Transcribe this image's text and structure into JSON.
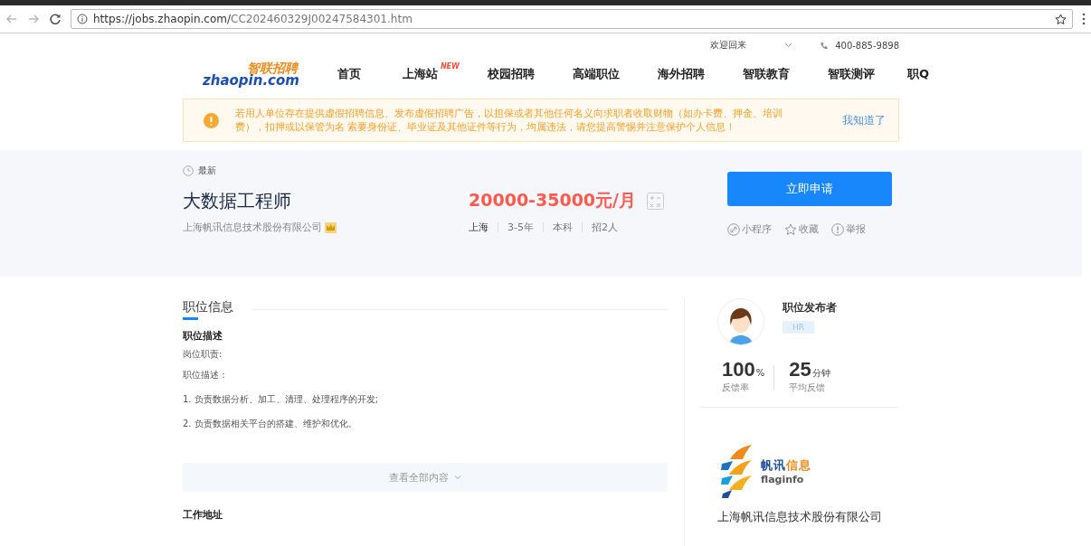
{
  "browser": {
    "url_host": "https://jobs.zhaopin.com/",
    "url_path": "CC202460329J00247584301.htm"
  },
  "header": {
    "welcome": "欢迎回来",
    "phone": "400-885-9898",
    "logo": {
      "cn": "智联招聘",
      "en": "zhaopin.com"
    },
    "nav": [
      {
        "label": "首页"
      },
      {
        "label": "上海站",
        "badge": "NEW"
      },
      {
        "label": "校园招聘"
      },
      {
        "label": "高端职位"
      },
      {
        "label": "海外招聘"
      },
      {
        "label": "智联教育"
      },
      {
        "label": "智联测评"
      },
      {
        "label": "职Q"
      }
    ]
  },
  "notice": {
    "text": "若用人单位存在提供虚假招聘信息、发布虚假招聘广告，以担保或者其他任何名义向求职者收取财物（如办卡费、押金、培训费），扣押或以保管为名 索要身份证、毕业证及其他证件等行为，均属违法，请您提高警惕并注意保护个人信息！",
    "action": "我知道了"
  },
  "job": {
    "tag": "最新",
    "title": "大数据工程师",
    "salary": "20000-35000元/月",
    "company": "上海帆讯信息技术股份有限公司",
    "meta": [
      "上海",
      "3-5年",
      "本科",
      "招2人"
    ],
    "apply": "立即申请",
    "actions": [
      {
        "kind": "miniapp",
        "label": "小程序"
      },
      {
        "kind": "star",
        "label": "收藏"
      },
      {
        "kind": "report",
        "label": "举报"
      }
    ]
  },
  "section": {
    "title": "职位信息",
    "subtitle": "职位描述",
    "lines": [
      "岗位职责:",
      "职位描述：",
      "1. 负责数据分析、加工、清理、处理程序的开发;",
      "2. 负责数据相关平台的搭建、维护和优化。"
    ],
    "more": "查看全部内容",
    "next_heading": "工作地址"
  },
  "publisher": {
    "title": "职位发布者",
    "role": "HR",
    "stats": [
      {
        "value": "100",
        "unit": "%",
        "label": "反馈率"
      },
      {
        "value": "25",
        "unit": "分钟",
        "label": "平均反馈"
      }
    ]
  },
  "company": {
    "logo_parts": [
      {
        "text": "帆讯",
        "color": "#1d4f9c"
      },
      {
        "text": "信息",
        "color": "#f08a1c"
      }
    ],
    "logo_en": "flaginfo",
    "name": "上海帆讯信息技术股份有限公司"
  }
}
